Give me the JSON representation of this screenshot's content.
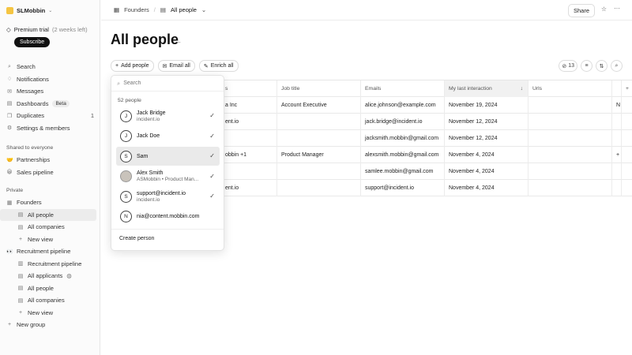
{
  "workspace": {
    "name": "SLMobbin"
  },
  "trial": {
    "label": "Premium trial",
    "remaining": "(2 weeks left)",
    "subscribe": "Subscribe"
  },
  "nav": [
    {
      "label": "Search",
      "icon": "search-icon"
    },
    {
      "label": "Notifications",
      "icon": "bell-icon"
    },
    {
      "label": "Messages",
      "icon": "mail-icon"
    },
    {
      "label": "Dashboards",
      "icon": "dashboard-icon",
      "badge": "Beta"
    },
    {
      "label": "Duplicates",
      "icon": "duplicate-icon",
      "count": "1"
    },
    {
      "label": "Settings & members",
      "icon": "gear-icon"
    }
  ],
  "shared": {
    "title": "Shared to everyone",
    "items": [
      {
        "label": "Partnerships"
      },
      {
        "label": "Sales pipeline"
      }
    ]
  },
  "private": {
    "title": "Private",
    "founders": "Founders",
    "founders_items": [
      "All people",
      "All companies",
      "New view"
    ],
    "recruitment": "Recruitment pipeline",
    "recruitment_items": [
      "Recruitment pipeline",
      "All applicants",
      "All people",
      "All companies",
      "New view"
    ],
    "new_group": "New group"
  },
  "topbar": {
    "crumb1": "Founders",
    "crumb2": "All people",
    "share": "Share"
  },
  "page": {
    "title": "All people"
  },
  "actions": {
    "add": "Add people",
    "email": "Email all",
    "enrich": "Enrich all",
    "hidden_count": "13"
  },
  "table": {
    "headers": [
      "s",
      "Job title",
      "Emails",
      "My last interaction",
      "Urls",
      ""
    ],
    "rows": [
      {
        "company": "a Inc",
        "job": "Account Executive",
        "email": "alice.johnson@example.com",
        "last": "November 19, 2024",
        "extra": "N"
      },
      {
        "company": "ent.io",
        "job": "",
        "email": "jack.bridge@incident.io",
        "last": "November 12, 2024",
        "extra": ""
      },
      {
        "company": "",
        "job": "",
        "email": "jacksmith.mobbin@gmail.com",
        "last": "November 12, 2024",
        "extra": ""
      },
      {
        "company": "obbin +1",
        "job": "Product Manager",
        "email": "alexsmith.mobbin@gmail.com",
        "last": "November 4, 2024",
        "extra": "+"
      },
      {
        "company": "",
        "job": "",
        "email": "samlee.mobbin@gmail.com",
        "last": "November 4, 2024",
        "extra": ""
      },
      {
        "company": "ent.io",
        "job": "",
        "email": "support@incident.io",
        "last": "November 4, 2024",
        "extra": ""
      }
    ]
  },
  "dropdown": {
    "placeholder": "Search",
    "count": "52 people",
    "items": [
      {
        "initial": "J",
        "name": "Jack Bridge",
        "sub": "incident.io",
        "checked": true
      },
      {
        "initial": "J",
        "name": "Jack Doe",
        "sub": "",
        "checked": true
      },
      {
        "initial": "S",
        "name": "Sam",
        "sub": "",
        "checked": true,
        "selected": true
      },
      {
        "initial": "",
        "name": "Alex Smith",
        "sub": "ASMobbin • Product Man...",
        "checked": true,
        "photo": true
      },
      {
        "initial": "S",
        "name": "support@incident.io",
        "sub": "incident.io",
        "checked": true
      },
      {
        "initial": "N",
        "name": "nia@content.mobbin.com",
        "sub": "",
        "checked": false
      }
    ],
    "create": "Create person"
  }
}
